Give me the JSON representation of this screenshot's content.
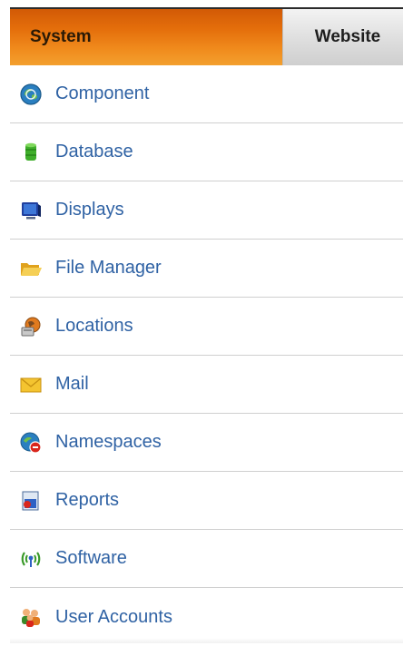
{
  "tabs": {
    "system": "System",
    "website": "Website"
  },
  "menu": [
    {
      "label": "Component",
      "icon": "component-globe-icon"
    },
    {
      "label": "Database",
      "icon": "database-icon"
    },
    {
      "label": "Displays",
      "icon": "monitor-icon"
    },
    {
      "label": "File Manager",
      "icon": "folder-icon"
    },
    {
      "label": "Locations",
      "icon": "locations-icon"
    },
    {
      "label": "Mail",
      "icon": "mail-envelope-icon"
    },
    {
      "label": "Namespaces",
      "icon": "namespaces-icon"
    },
    {
      "label": "Reports",
      "icon": "reports-icon"
    },
    {
      "label": "Software",
      "icon": "software-antenna-icon"
    },
    {
      "label": "User Accounts",
      "icon": "user-accounts-icon"
    }
  ],
  "colors": {
    "active_tab": "#e46e0b",
    "link": "#2f62a4",
    "divider": "#cfcfcf"
  }
}
